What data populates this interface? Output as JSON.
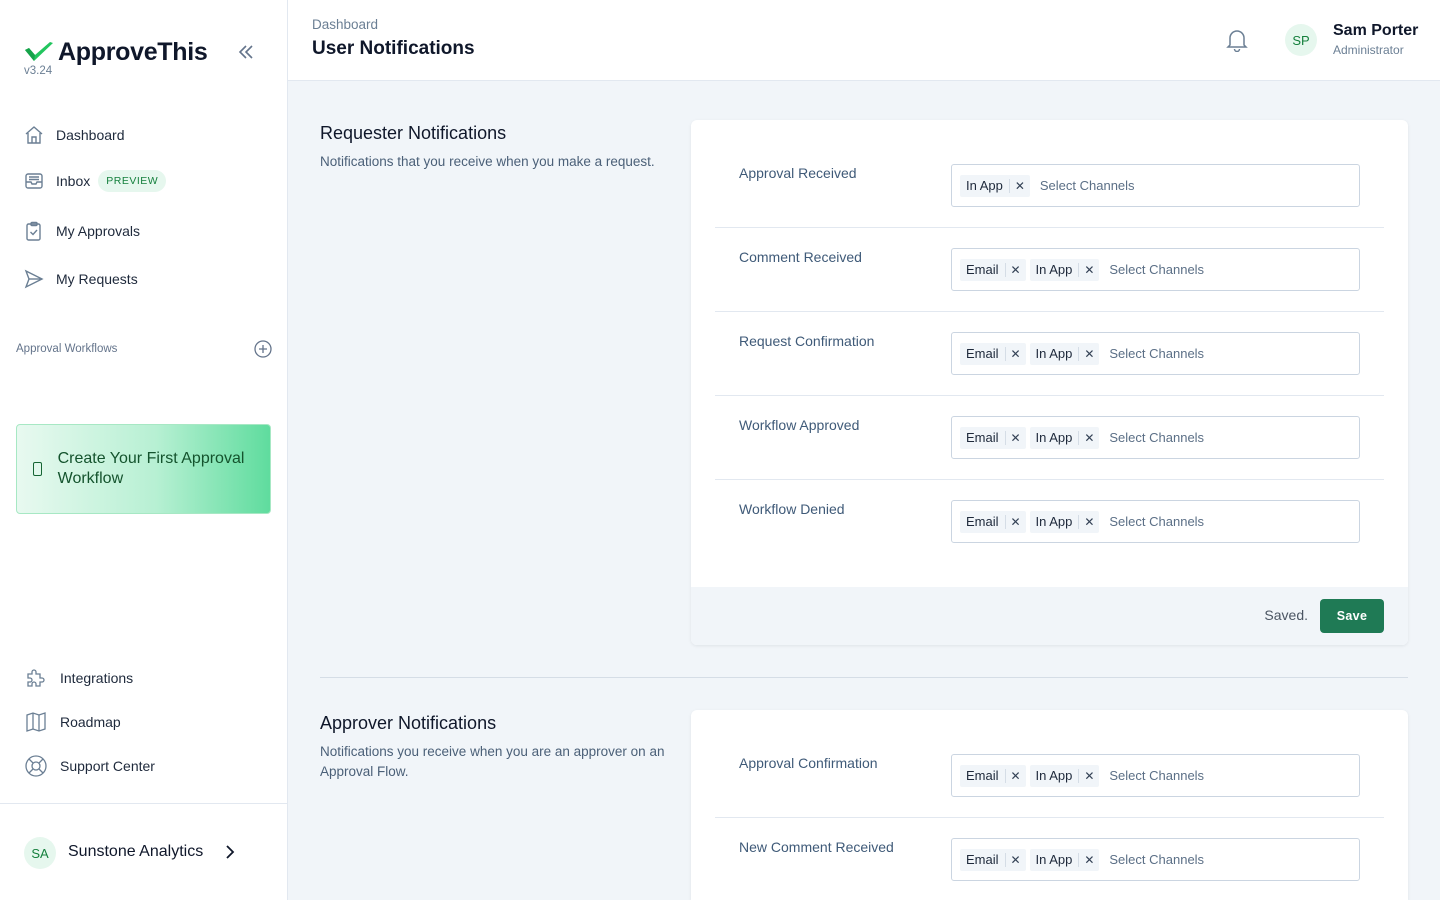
{
  "app": {
    "name": "ApproveThis",
    "version": "v3.24",
    "brand_color": "#1f7a55"
  },
  "sidebar": {
    "nav": [
      {
        "label": "Dashboard",
        "icon": "home-icon"
      },
      {
        "label": "Inbox",
        "icon": "inbox-icon",
        "badge": "PREVIEW"
      },
      {
        "label": "My Approvals",
        "icon": "clipboard-check-icon"
      },
      {
        "label": "My Requests",
        "icon": "send-icon"
      }
    ],
    "workflows_title": "Approval Workflows",
    "create_card": "Create Your First Approval Workflow",
    "bottom_nav": [
      {
        "label": "Integrations",
        "icon": "puzzle-icon"
      },
      {
        "label": "Roadmap",
        "icon": "map-icon"
      },
      {
        "label": "Support Center",
        "icon": "lifebuoy-icon"
      }
    ],
    "org": {
      "initials": "SA",
      "name": "Sunstone Analytics"
    }
  },
  "header": {
    "breadcrumb": "Dashboard",
    "title": "User Notifications",
    "user": {
      "initials": "SP",
      "name": "Sam Porter",
      "role": "Administrator"
    }
  },
  "channel_placeholder": "Select Channels",
  "sections": [
    {
      "title": "Requester Notifications",
      "description": "Notifications that you receive when you make a request.",
      "rows": [
        {
          "label": "Approval Received",
          "channels": [
            "In App"
          ]
        },
        {
          "label": "Comment Received",
          "channels": [
            "Email",
            "In App"
          ]
        },
        {
          "label": "Request Confirmation",
          "channels": [
            "Email",
            "In App"
          ]
        },
        {
          "label": "Workflow Approved",
          "channels": [
            "Email",
            "In App"
          ]
        },
        {
          "label": "Workflow Denied",
          "channels": [
            "Email",
            "In App"
          ]
        }
      ],
      "status": "Saved.",
      "save_label": "Save"
    },
    {
      "title": "Approver Notifications",
      "description": "Notifications you receive when you are an approver on an Approval Flow.",
      "rows": [
        {
          "label": "Approval Confirmation",
          "channels": [
            "Email",
            "In App"
          ]
        },
        {
          "label": "New Comment Received",
          "channels": [
            "Email",
            "In App"
          ]
        }
      ]
    }
  ]
}
